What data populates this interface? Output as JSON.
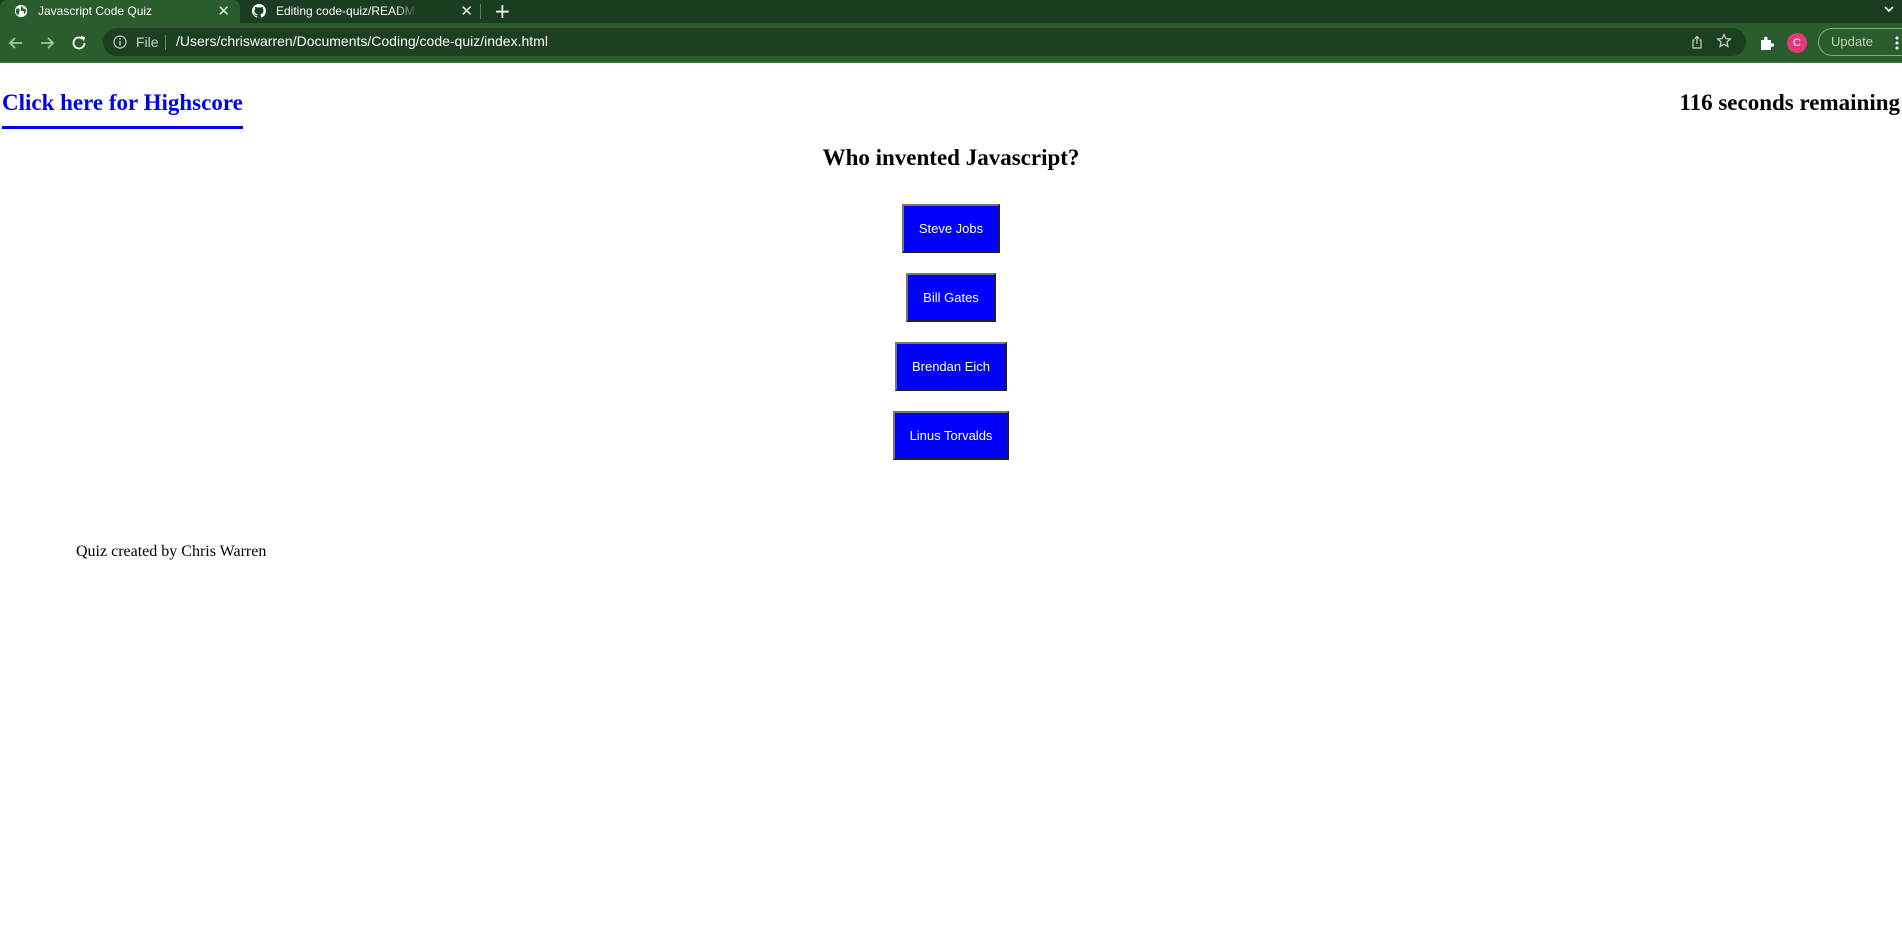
{
  "browser": {
    "tabs": [
      {
        "title": "Javascript Code Quiz",
        "icon": "globe-icon",
        "active": true
      },
      {
        "title": "Editing code-quiz/README.md",
        "icon": "github-icon",
        "active": false
      }
    ],
    "address_bar": {
      "scheme_label": "File",
      "url": "/Users/chriswarren/Documents/Coding/code-quiz/index.html"
    },
    "profile_initial": "C",
    "update_label": "Update",
    "colors": {
      "tabstrip": "#1b3d1f",
      "toolbar": "#2a5c2d",
      "avatar": "#e6397a"
    }
  },
  "page": {
    "highscore_link": "Click here for Highscore",
    "timer_text": "116 seconds remaining",
    "question": "Who invented Javascript?",
    "answers": [
      "Steve Jobs",
      "Bill Gates",
      "Brendan Eich",
      "Linus Torvalds"
    ],
    "footer": "Quiz created by Chris Warren",
    "colors": {
      "link": "#0000ee",
      "answer_button": "#0000ff"
    }
  }
}
